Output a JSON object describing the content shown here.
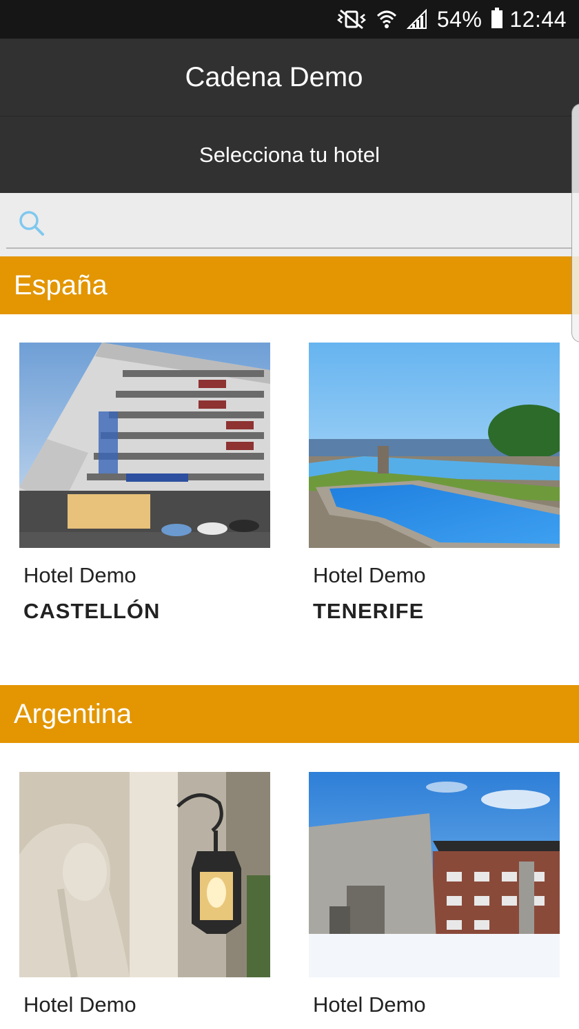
{
  "status_bar": {
    "battery_percent": "54%",
    "time": "12:44",
    "icons": [
      "mute-vibrate-icon",
      "wifi-icon",
      "signal-icon",
      "battery-icon"
    ]
  },
  "header": {
    "title": "Cadena Demo",
    "subtitle": "Selecciona tu hotel"
  },
  "search": {
    "placeholder": "",
    "value": "",
    "icon": "search-icon"
  },
  "colors": {
    "accent": "#e39602",
    "appbar": "#313131",
    "statusbar": "#161616",
    "search_icon": "#7fc8ef"
  },
  "sections": [
    {
      "name": "España",
      "hotels": [
        {
          "line1": "Hotel Demo",
          "line2": "CASTELLÓN"
        },
        {
          "line1": "Hotel Demo",
          "line2": "TENERIFE"
        }
      ]
    },
    {
      "name": "Argentina",
      "hotels": [
        {
          "line1": "Hotel Demo",
          "line2": ""
        },
        {
          "line1": "Hotel Demo",
          "line2": ""
        }
      ]
    }
  ]
}
